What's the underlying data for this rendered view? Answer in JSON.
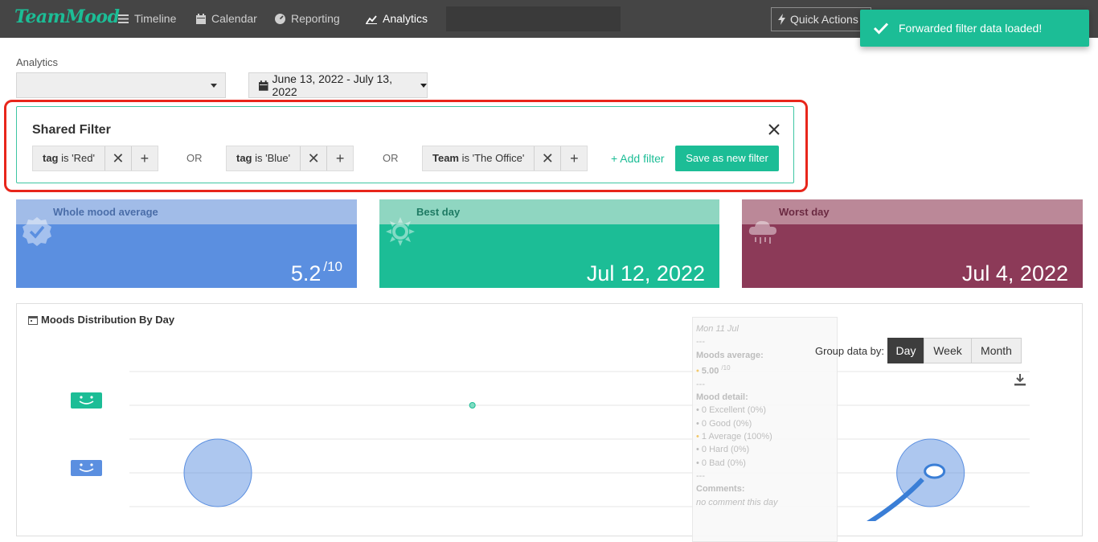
{
  "nav": {
    "logo": "TeamMood",
    "items": [
      {
        "label": "Timeline"
      },
      {
        "label": "Calendar"
      },
      {
        "label": "Reporting"
      },
      {
        "label": "Analytics"
      }
    ],
    "quick_actions": "Quick Actions"
  },
  "toast": {
    "message": "Forwarded filter data loaded!"
  },
  "analytics": {
    "label": "Analytics",
    "select_value": "",
    "date_range": "June 13, 2022 - July 13, 2022"
  },
  "filter": {
    "title": "Shared Filter",
    "chips": [
      {
        "field": "tag",
        "op": " is ",
        "value": "'Red'"
      },
      {
        "field": "tag",
        "op": " is ",
        "value": "'Blue'"
      },
      {
        "field": "Team",
        "op": " is ",
        "value": "'The Office'"
      }
    ],
    "or_label": "OR",
    "add_filter": "+ Add filter",
    "save_button": "Save as new filter"
  },
  "cards": [
    {
      "title": "Whole mood average",
      "value": "5.2",
      "suffix": "/10",
      "head_color": "#a1bce8",
      "body_color": "#5b8fe0",
      "icon": "badge-check-icon"
    },
    {
      "title": "Best day",
      "value": "Jul 12, 2022",
      "suffix": "",
      "head_color": "#8fd6c1",
      "body_color": "#1cbd96",
      "icon": "sun-icon"
    },
    {
      "title": "Worst day",
      "value": "Jul 4, 2022",
      "suffix": "",
      "head_color": "#bb8898",
      "body_color": "#8c3a58",
      "icon": "rain-cloud-icon"
    }
  ],
  "chart": {
    "title": "Moods Distribution By Day",
    "group_label": "Group data by:",
    "group_options": [
      "Day",
      "Week",
      "Month"
    ],
    "group_selected": "Day",
    "tooltip": {
      "date": "Mon 11 Jul",
      "sep": "---",
      "avg_label": "Moods average:",
      "avg_value": "5.00",
      "avg_suffix": "/10",
      "detail_label": "Mood detail:",
      "details": [
        "0 Excellent (0%)",
        "0 Good (0%)",
        "1 Average (100%)",
        "0 Hard (0%)",
        "0 Bad (0%)"
      ],
      "comments_label": "Comments:",
      "comments_value": "no comment this day"
    }
  },
  "chart_data": {
    "type": "scatter",
    "title": "Moods Distribution By Day",
    "series": [
      {
        "mood": "Good",
        "points": [
          {
            "x": "Jun 23, 2022",
            "size": 1
          }
        ]
      },
      {
        "mood": "Average",
        "points": [
          {
            "x": "Jun 13, 2022",
            "size": 1
          },
          {
            "x": "Jul 11, 2022",
            "size": 1
          }
        ]
      }
    ],
    "grid": true
  }
}
